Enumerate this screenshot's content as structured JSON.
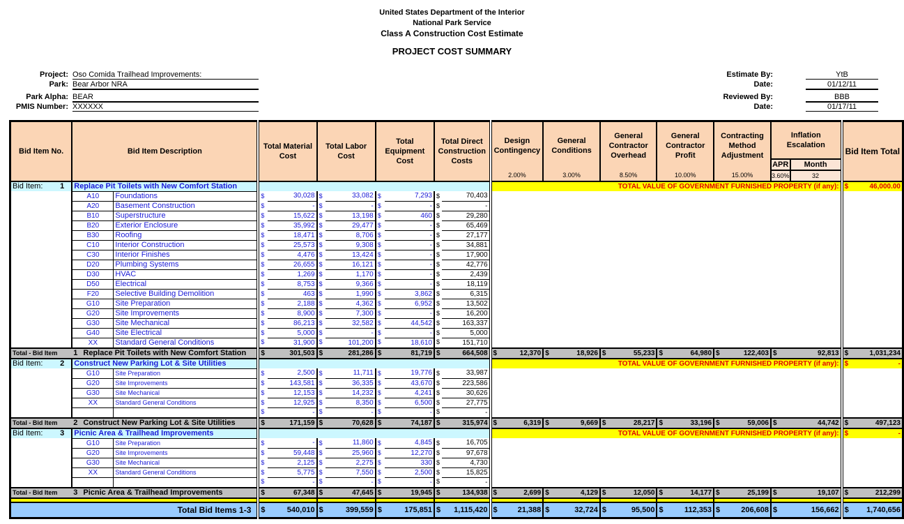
{
  "header": {
    "line1": "United States Department of the Interior",
    "line2": "National Park Service",
    "line3": "Class A Construction Cost Estimate",
    "title": "PROJECT COST SUMMARY"
  },
  "project_info": {
    "project_label": "Project:",
    "project": "Oso Comida Trailhead Improvements:",
    "park_label": "Park:",
    "park": "Bear Arbor NRA",
    "alpha_label": "Park Alpha:",
    "alpha": "BEAR",
    "pmis_label": "PMIS Number:",
    "pmis": "XXXXXX",
    "estimate_by_label": "Estimate By:",
    "estimate_by": "YtB",
    "date1_label": "Date:",
    "date1": "01/12/11",
    "reviewed_by_label": "Reviewed By:",
    "reviewed_by": "BBB",
    "date2_label": "Date:",
    "date2": "01/17/11"
  },
  "columns": {
    "bid_no": "Bid Item No.",
    "desc": "Bid Item Description",
    "material": "Total Material Cost",
    "labor": "Total Labor Cost",
    "equipment": "Total Equipment Cost",
    "direct": "Total Direct Construction Costs",
    "design": "Design Contingency",
    "conditions": "General Conditions",
    "overhead": "General Contractor Overhead",
    "profit": "General Contractor Profit",
    "method": "Contracting Method Adjustment",
    "inflation": "Inflation Escalation",
    "apr": "APR",
    "month": "Month",
    "total": "Bid Item Total"
  },
  "rates": {
    "design": "2.00%",
    "conditions": "3.00%",
    "overhead": "8.50%",
    "profit": "10.00%",
    "method": "15.00%",
    "apr": "3.60%",
    "month": "32"
  },
  "dollar": "$",
  "gfp_label": "TOTAL VALUE OF GOVERNMENT FURNISHED PROPERTY (if any):",
  "bid_label": "Bid Item:",
  "total_label": "Total - Bid Item",
  "bid_items": [
    {
      "no": "1",
      "title": "Replace Pit Toilets with New Comfort Station",
      "gfp": "46,000.00",
      "lines": [
        [
          "A10",
          "Foundations",
          "30,028",
          "33,082",
          "7,293",
          "70,403"
        ],
        [
          "A20",
          "Basement Construction",
          "-",
          "-",
          "-",
          "-"
        ],
        [
          "B10",
          "Superstructure",
          "15,622",
          "13,198",
          "460",
          "29,280"
        ],
        [
          "B20",
          "Exterior Enclosure",
          "35,992",
          "29,477",
          "-",
          "65,469"
        ],
        [
          "B30",
          "Roofing",
          "18,471",
          "8,706",
          "-",
          "27,177"
        ],
        [
          "C10",
          "Interior Construction",
          "25,573",
          "9,308",
          "-",
          "34,881"
        ],
        [
          "C30",
          "Interior Finishes",
          "4,476",
          "13,424",
          "-",
          "17,900"
        ],
        [
          "D20",
          "Plumbing Systems",
          "26,655",
          "16,121",
          "-",
          "42,776"
        ],
        [
          "D30",
          "HVAC",
          "1,269",
          "1,170",
          "-",
          "2,439"
        ],
        [
          "D50",
          "Electrical",
          "8,753",
          "9,366",
          "-",
          "18,119"
        ],
        [
          "F20",
          "Selective Building Demolition",
          "463",
          "1,990",
          "3,862",
          "6,315"
        ],
        [
          "G10",
          "Site Preparation",
          "2,188",
          "4,362",
          "6,952",
          "13,502"
        ],
        [
          "G20",
          "Site Improvements",
          "8,900",
          "7,300",
          "-",
          "16,200"
        ],
        [
          "G30",
          "Site Mechanical",
          "86,213",
          "32,582",
          "44,542",
          "163,337"
        ],
        [
          "G40",
          "Site Electrical",
          "5,000",
          "-",
          "-",
          "5,000"
        ],
        [
          "XX",
          "Standard General Conditions",
          "31,900",
          "101,200",
          "18,610",
          "151,710"
        ]
      ],
      "totals": [
        "301,503",
        "281,286",
        "81,719",
        "664,508",
        "12,370",
        "18,926",
        "55,233",
        "64,980",
        "122,403",
        "92,813",
        "1,031,234"
      ]
    },
    {
      "no": "2",
      "title": "Construct New Parking Lot & Site Utilities",
      "gfp": "-",
      "lines": [
        [
          "G10",
          "Site Preparation",
          "2,500",
          "11,711",
          "19,776",
          "33,987"
        ],
        [
          "G20",
          "Site Improvements",
          "143,581",
          "36,335",
          "43,670",
          "223,586"
        ],
        [
          "G30",
          "Site Mechanical",
          "12,153",
          "14,232",
          "4,241",
          "30,626"
        ],
        [
          "XX",
          "Standard General Conditions",
          "12,925",
          "8,350",
          "6,500",
          "27,775"
        ],
        [
          "",
          "",
          "-",
          "-",
          "-",
          "-"
        ]
      ],
      "totals": [
        "171,159",
        "70,628",
        "74,187",
        "315,974",
        "6,319",
        "9,669",
        "28,217",
        "33,196",
        "59,006",
        "44,742",
        "497,123"
      ]
    },
    {
      "no": "3",
      "title": "Picnic Area & Trailhead Improvements",
      "gfp": "-",
      "lines": [
        [
          "G10",
          "Site Preparation",
          "-",
          "11,860",
          "4,845",
          "16,705"
        ],
        [
          "G20",
          "Site Improvements",
          "59,448",
          "25,960",
          "12,270",
          "97,678"
        ],
        [
          "G30",
          "Site Mechanical",
          "2,125",
          "2,275",
          "330",
          "4,730"
        ],
        [
          "XX",
          "Standard General Conditions",
          "5,775",
          "7,550",
          "2,500",
          "15,825"
        ],
        [
          "",
          "",
          "-",
          "-",
          "-",
          "-"
        ]
      ],
      "totals": [
        "67,348",
        "47,645",
        "19,945",
        "134,938",
        "2,699",
        "4,129",
        "12,050",
        "14,177",
        "25,199",
        "19,107",
        "212,299"
      ]
    }
  ],
  "grand": {
    "label": "Total Bid Items 1-3",
    "values": [
      "540,010",
      "399,559",
      "175,851",
      "1,115,420",
      "21,388",
      "32,724",
      "95,500",
      "112,353",
      "206,608",
      "156,662",
      "1,740,656"
    ]
  }
}
